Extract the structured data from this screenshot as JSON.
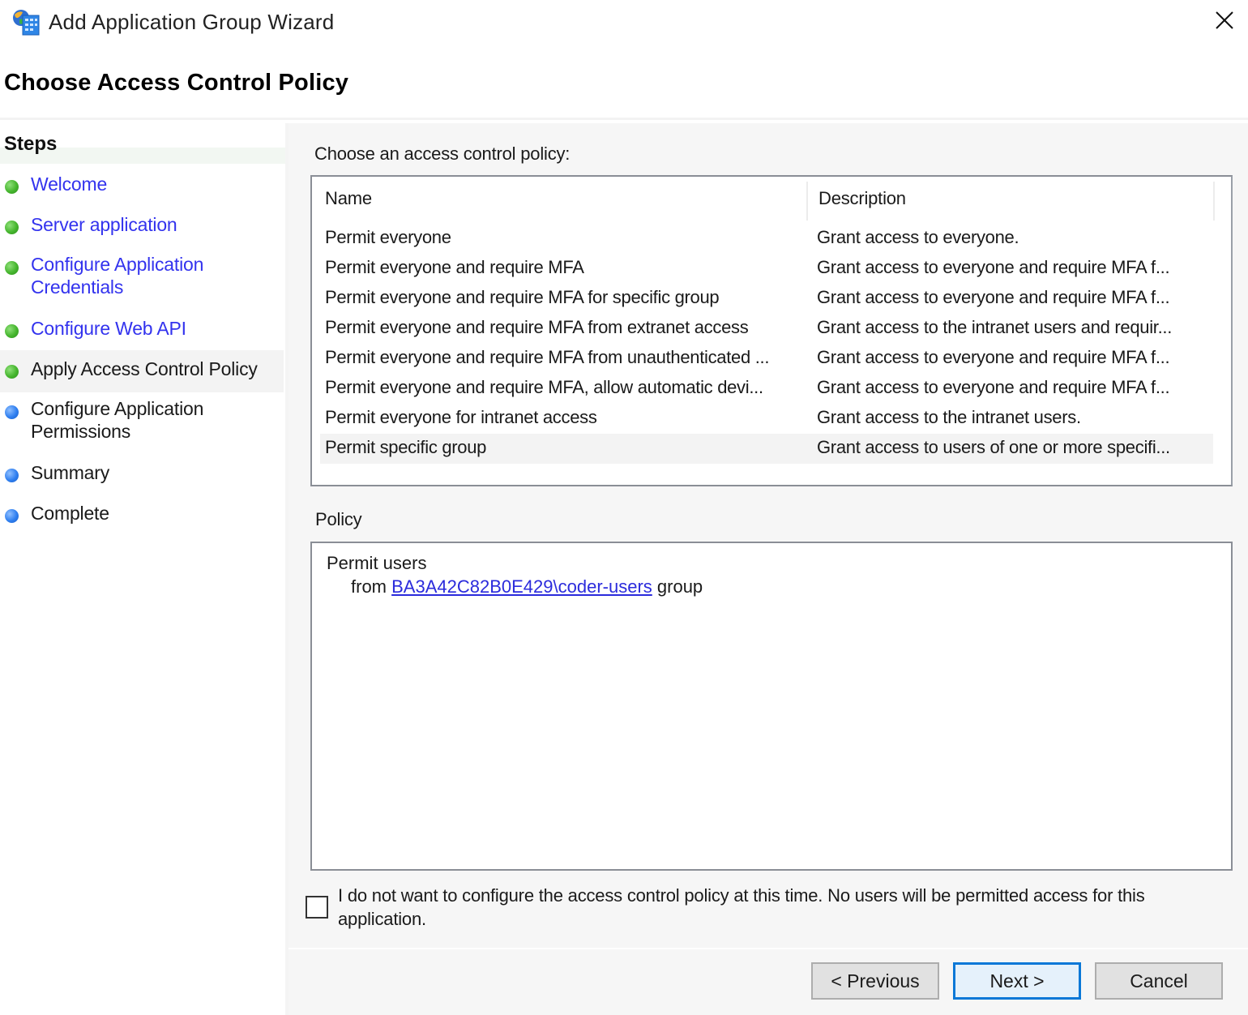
{
  "window": {
    "title": "Add Application Group Wizard",
    "icon": "application-group-icon",
    "close_icon": "close-icon"
  },
  "page": {
    "title": "Choose Access Control Policy"
  },
  "sidebar": {
    "title": "Steps",
    "items": [
      {
        "label": "Welcome",
        "status": "done",
        "dot_color": "#45b52d",
        "is_link": true,
        "current": false
      },
      {
        "label": "Server application",
        "status": "done",
        "dot_color": "#45b52d",
        "is_link": true,
        "current": false
      },
      {
        "label": "Configure Application Credentials",
        "line1": "Configure Application",
        "line2": "Credentials",
        "status": "done",
        "dot_color": "#45b52d",
        "is_link": true,
        "current": false
      },
      {
        "label": "Configure Web API",
        "status": "done",
        "dot_color": "#45b52d",
        "is_link": true,
        "current": false
      },
      {
        "label": "Apply Access Control Policy",
        "status": "current",
        "dot_color": "#45b52d",
        "is_link": false,
        "current": true
      },
      {
        "label": "Configure Application Permissions",
        "line1": "Configure Application",
        "line2": "Permissions",
        "status": "pending",
        "dot_color": "#2f7ff0",
        "is_link": false,
        "current": false
      },
      {
        "label": "Summary",
        "status": "pending",
        "dot_color": "#2f7ff0",
        "is_link": false,
        "current": false
      },
      {
        "label": "Complete",
        "status": "pending",
        "dot_color": "#2f7ff0",
        "is_link": false,
        "current": false
      }
    ]
  },
  "main": {
    "choose_label": "Choose an access control policy:",
    "table": {
      "columns": [
        "Name",
        "Description"
      ],
      "rows": [
        {
          "name": "Permit everyone",
          "description": "Grant access to everyone.",
          "selected": false
        },
        {
          "name": "Permit everyone and require MFA",
          "description": "Grant access to everyone and require MFA f...",
          "selected": false
        },
        {
          "name": "Permit everyone and require MFA for specific group",
          "description": "Grant access to everyone and require MFA f...",
          "selected": false
        },
        {
          "name": "Permit everyone and require MFA from extranet access",
          "description": "Grant access to the intranet users and requir...",
          "selected": false
        },
        {
          "name": "Permit everyone and require MFA from unauthenticated ...",
          "description": "Grant access to everyone and require MFA f...",
          "selected": false
        },
        {
          "name": "Permit everyone and require MFA, allow automatic devi...",
          "description": "Grant access to everyone and require MFA f...",
          "selected": false
        },
        {
          "name": "Permit everyone for intranet access",
          "description": "Grant access to the intranet users.",
          "selected": false
        },
        {
          "name": "Permit specific group",
          "description": "Grant access to users of one or more specifi...",
          "selected": true
        }
      ]
    },
    "policy_label": "Policy",
    "policy": {
      "line1": "Permit users",
      "line2_prefix": "from ",
      "group_link": "BA3A42C82B0E429\\coder-users",
      "line2_suffix": " group"
    },
    "skip_checkbox": {
      "checked": false,
      "label": "I do not want to configure the access control policy at this time.  No users will be permitted access for this application."
    }
  },
  "buttons": {
    "previous": "< Previous",
    "next": "Next >",
    "cancel": "Cancel"
  },
  "colors": {
    "link": "#3333ee",
    "step_done": "#45b52d",
    "step_pending": "#2f7ff0",
    "default_button_border": "#0a78d7"
  }
}
